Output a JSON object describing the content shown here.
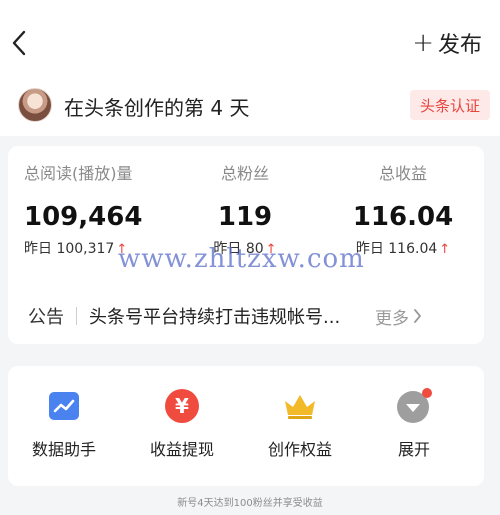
{
  "header": {
    "publish_plus": "+",
    "publish_label": "发布"
  },
  "creator": {
    "text": "在头条创作的第 4 天",
    "verify_label": "头条认证"
  },
  "stats": [
    {
      "label": "总阅读(播放)量",
      "value": "109,464",
      "yesterday": "昨日 100,317",
      "arrow": "↑"
    },
    {
      "label": "总粉丝",
      "value": "119",
      "yesterday": "昨日 80",
      "arrow": "↑"
    },
    {
      "label": "总收益",
      "value": "116.04",
      "yesterday": "昨日 116.04",
      "arrow": "↑"
    }
  ],
  "watermark": "www.zhltzxw.com",
  "notice": {
    "tag": "公告",
    "message": "头条号平台持续打击违规帐号...",
    "more": "更多"
  },
  "tools": [
    {
      "label": "数据助手",
      "icon": "chart-icon"
    },
    {
      "label": "收益提现",
      "icon": "yen-icon"
    },
    {
      "label": "创作权益",
      "icon": "crown-icon"
    },
    {
      "label": "展开",
      "icon": "expand-icon"
    }
  ],
  "colors": {
    "accent_red": "#e8453c",
    "chart_blue": "#4a82f0",
    "crown_yellow": "#f2b928"
  },
  "footer": "新号4天达到100粉丝并享受收益"
}
